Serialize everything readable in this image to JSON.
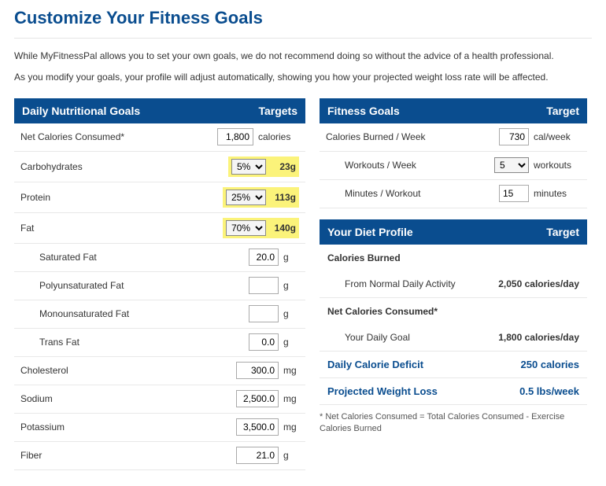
{
  "page": {
    "title": "Customize Your Fitness Goals",
    "intro1": "While MyFitnessPal allows you to set your own goals, we do not recommend doing so without the advice of a health professional.",
    "intro2": "As you modify your goals, your profile will adjust automatically, showing you how your projected weight loss rate will be affected."
  },
  "nutrition": {
    "header": "Daily Nutritional Goals",
    "targets_label": "Targets",
    "rows": {
      "net_cal": {
        "label": "Net Calories Consumed*",
        "value": "1,800",
        "unit": "calories"
      },
      "carbs": {
        "label": "Carbohydrates",
        "pct": "5%",
        "grams": "23g"
      },
      "protein": {
        "label": "Protein",
        "pct": "25%",
        "grams": "113g"
      },
      "fat": {
        "label": "Fat",
        "pct": "70%",
        "grams": "140g"
      },
      "satfat": {
        "label": "Saturated Fat",
        "value": "20.0",
        "unit": "g"
      },
      "poly": {
        "label": "Polyunsaturated Fat",
        "value": "",
        "unit": "g"
      },
      "mono": {
        "label": "Monounsaturated Fat",
        "value": "",
        "unit": "g"
      },
      "trans": {
        "label": "Trans Fat",
        "value": "0.0",
        "unit": "g"
      },
      "chol": {
        "label": "Cholesterol",
        "value": "300.0",
        "unit": "mg"
      },
      "sodium": {
        "label": "Sodium",
        "value": "2,500.0",
        "unit": "mg"
      },
      "potassium": {
        "label": "Potassium",
        "value": "3,500.0",
        "unit": "mg"
      },
      "fiber": {
        "label": "Fiber",
        "value": "21.0",
        "unit": "g"
      }
    }
  },
  "fitness": {
    "header": "Fitness Goals",
    "target_label": "Target",
    "rows": {
      "burned": {
        "label": "Calories Burned / Week",
        "value": "730",
        "unit": "cal/week"
      },
      "workouts": {
        "label": "Workouts / Week",
        "value": "5",
        "unit": "workouts"
      },
      "minutes": {
        "label": "Minutes / Workout",
        "value": "15",
        "unit": "minutes"
      }
    }
  },
  "profile": {
    "header": "Your Diet Profile",
    "target_label": "Target",
    "burned_header": "Calories Burned",
    "burned_from_activity_label": "From Normal Daily Activity",
    "burned_from_activity_value": "2,050 calories/day",
    "net_header": "Net Calories Consumed*",
    "daily_goal_label": "Your Daily Goal",
    "daily_goal_value": "1,800 calories/day",
    "deficit_label": "Daily Calorie Deficit",
    "deficit_value": "250 calories",
    "projected_label": "Projected Weight Loss",
    "projected_value": "0.5 lbs/week",
    "footnote": "* Net Calories Consumed = Total Calories Consumed - Exercise Calories Burned"
  }
}
